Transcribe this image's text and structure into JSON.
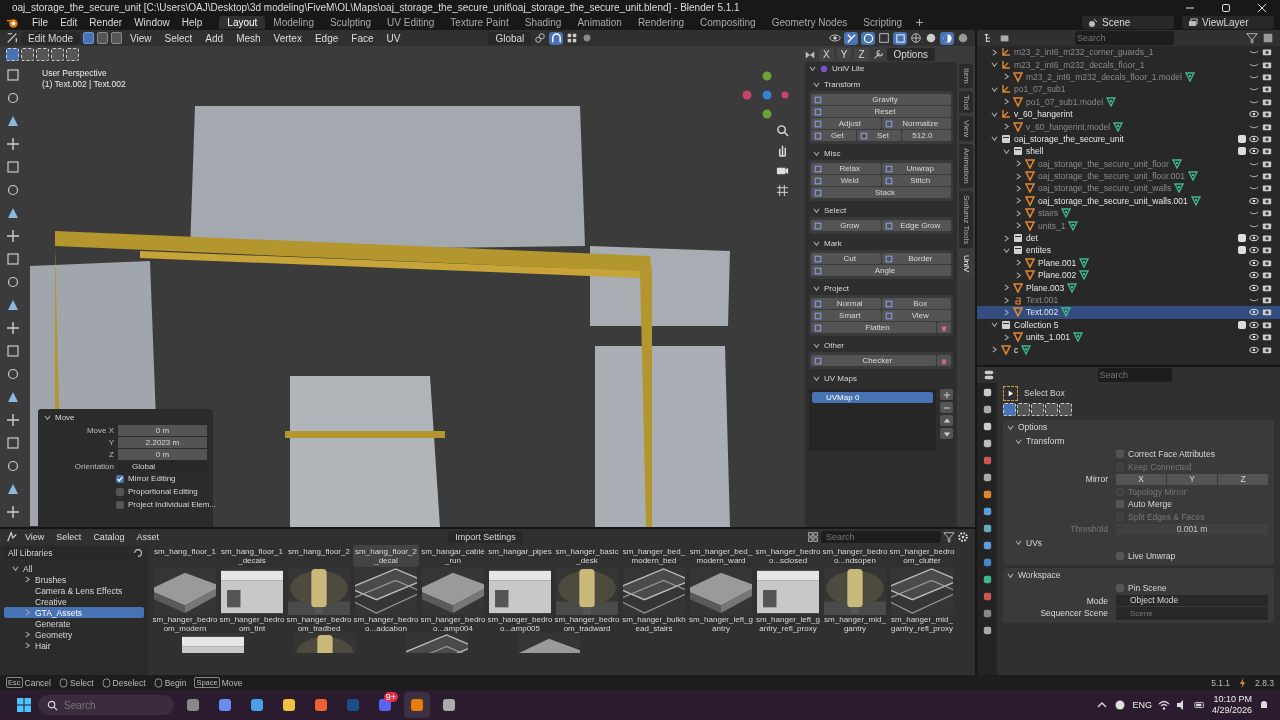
{
  "window": {
    "title": "oaj_storage_the_secure_unit [C:\\Users\\OAJ\\Desktop\\3d modeling\\FiveM\\OL\\Maps\\oaj_storage_the_secure_unit\\oaj_storage_the_secure_unit.blend] - Blender 5.1.1"
  },
  "menu": [
    "File",
    "Edit",
    "Render",
    "Window",
    "Help"
  ],
  "workspaces": [
    {
      "label": "Layout",
      "selected": true
    },
    {
      "label": "Modeling",
      "selected": false
    },
    {
      "label": "Sculpting",
      "selected": false
    },
    {
      "label": "UV Editing",
      "selected": false
    },
    {
      "label": "Texture Paint",
      "selected": false
    },
    {
      "label": "Shading",
      "selected": false
    },
    {
      "label": "Animation",
      "selected": false
    },
    {
      "label": "Rendering",
      "selected": false
    },
    {
      "label": "Compositing",
      "selected": false
    },
    {
      "label": "Geometry Nodes",
      "selected": false
    },
    {
      "label": "Scripting",
      "selected": false
    }
  ],
  "scene": "Scene",
  "view_layer": "ViewLayer",
  "viewport": {
    "mode": "Edit Mode",
    "menus": [
      "View",
      "Select",
      "Add",
      "Mesh",
      "Vertex",
      "Edge",
      "Face",
      "UV"
    ],
    "select_modes": [
      {
        "selected": true
      },
      {
        "selected": false
      },
      {
        "selected": false
      }
    ],
    "orientation": "Global",
    "axes": [
      "X",
      "Y",
      "Z"
    ],
    "options": "Options",
    "view_name": "User Perspective",
    "object_info": "(1) Text.002 | Text.002"
  },
  "operator_panel": {
    "title": "Move",
    "fields": [
      {
        "label": "Move X",
        "value": "0 m"
      },
      {
        "label": "Y",
        "value": "2.2023 m"
      },
      {
        "label": "Z",
        "value": "0 m"
      }
    ],
    "orientation_label": "Orientation",
    "orientation": "Global",
    "options": [
      {
        "label": "Mirror Editing",
        "checked": true
      },
      {
        "label": "Proportional Editing",
        "checked": false
      },
      {
        "label": "Project Individual Elem...",
        "checked": false
      }
    ]
  },
  "sidebar": {
    "addon": "UniV Lite",
    "sections": [
      {
        "title": "Transform",
        "rows": [
          {
            "buttons": [
              {
                "kind": "button",
                "label": "Gravity"
              }
            ]
          },
          {
            "buttons": [
              {
                "kind": "button",
                "label": "Reset"
              }
            ]
          },
          {
            "buttons": [
              {
                "kind": "button",
                "label": "Adjust"
              },
              {
                "kind": "button",
                "label": "Normalize"
              }
            ]
          },
          {
            "buttons": [
              {
                "kind": "button",
                "label": "Get"
              },
              {
                "kind": "button",
                "label": "Set"
              },
              {
                "kind": "field",
                "label": "512.0"
              }
            ]
          }
        ]
      },
      {
        "title": "Misc",
        "rows": [
          {
            "buttons": [
              {
                "kind": "button",
                "label": "Relax"
              },
              {
                "kind": "button",
                "label": "Unwrap"
              }
            ]
          },
          {
            "buttons": [
              {
                "kind": "button",
                "label": "Weld"
              },
              {
                "kind": "button",
                "label": "Stitch"
              }
            ]
          },
          {
            "buttons": [
              {
                "kind": "button",
                "label": "Stack"
              }
            ]
          }
        ]
      },
      {
        "title": "Select",
        "rows": [
          {
            "buttons": [
              {
                "kind": "button",
                "label": "Grow"
              },
              {
                "kind": "button",
                "label": "Edge Grow"
              }
            ]
          }
        ]
      },
      {
        "title": "Mark",
        "rows": [
          {
            "buttons": [
              {
                "kind": "button",
                "label": "Cut"
              },
              {
                "kind": "button",
                "label": "Border"
              }
            ]
          },
          {
            "buttons": [
              {
                "kind": "button",
                "label": "Angle"
              }
            ]
          }
        ]
      },
      {
        "title": "Project",
        "rows": [
          {
            "buttons": [
              {
                "kind": "button",
                "label": "Normal"
              },
              {
                "kind": "button",
                "label": "Box"
              }
            ]
          },
          {
            "buttons": [
              {
                "kind": "button",
                "label": "Smart"
              },
              {
                "kind": "button",
                "label": "View"
              }
            ]
          },
          {
            "buttons": [
              {
                "kind": "button",
                "label": "Flatten"
              },
              {
                "kind": "delete"
              }
            ]
          }
        ]
      },
      {
        "title": "Other",
        "rows": [
          {
            "buttons": [
              {
                "kind": "button",
                "label": "Checker"
              },
              {
                "kind": "delete"
              }
            ]
          }
        ]
      }
    ],
    "uv_maps_title": "UV Maps",
    "uv_maps": [
      {
        "name": "UVMap 0",
        "selected": true
      }
    ],
    "tabs": [
      {
        "label": "Item",
        "selected": false
      },
      {
        "label": "Tool",
        "selected": false
      },
      {
        "label": "View",
        "selected": false
      },
      {
        "label": "Animation",
        "selected": false
      },
      {
        "label": "Sollumz Tools",
        "selected": false
      },
      {
        "label": "UniV",
        "selected": true
      }
    ]
  },
  "outliner": {
    "search_placeholder": "Search",
    "rows": [
      {
        "name": "m23_2_int6_m232_corner_guards_1",
        "kind": "empty",
        "visible": false,
        "expanded": false,
        "selected": false
      },
      {
        "name": "m23_2_int6_m232_decals_floor_1",
        "kind": "empty",
        "visible": false,
        "expanded": true,
        "selected": false,
        "children": [
          {
            "name": "m23_2_int6_m232_decals_floor_1.model",
            "kind": "mesh",
            "visible": false,
            "expanded": false,
            "selected": false
          }
        ]
      },
      {
        "name": "po1_07_sub1",
        "kind": "empty",
        "visible": false,
        "expanded": true,
        "selected": false,
        "children": [
          {
            "name": "po1_07_sub1.model",
            "kind": "mesh",
            "visible": false,
            "expanded": false,
            "selected": false
          }
        ]
      },
      {
        "name": "v_60_hangerint",
        "kind": "empty",
        "visible": true,
        "expanded": true,
        "selected": false,
        "children": [
          {
            "name": "v_60_hangerint.model",
            "kind": "mesh",
            "visible": false,
            "expanded": false,
            "selected": false
          }
        ]
      },
      {
        "name": "oaj_storage_the_secure_unit",
        "kind": "collection",
        "checked": true,
        "visible": true,
        "expanded": true,
        "selected": false,
        "children": [
          {
            "name": "shell",
            "kind": "collection",
            "checked": true,
            "visible": true,
            "expanded": true,
            "selected": false,
            "children": [
              {
                "name": "oaj_storage_the_secure_unit_floor",
                "kind": "mesh",
                "visible": false,
                "expanded": false,
                "selected": false
              },
              {
                "name": "oaj_storage_the_secure_unit_floor.001",
                "kind": "mesh",
                "visible": false,
                "expanded": false,
                "selected": false
              },
              {
                "name": "oaj_storage_the_secure_unit_walls",
                "kind": "mesh",
                "visible": false,
                "expanded": false,
                "selected": false
              },
              {
                "name": "oaj_storage_the_secure_unit_walls.001",
                "kind": "mesh",
                "visible": true,
                "expanded": false,
                "selected": false
              },
              {
                "name": "stairs",
                "kind": "mesh",
                "visible": false,
                "expanded": false,
                "selected": false
              },
              {
                "name": "units_1",
                "kind": "mesh",
                "visible": false,
                "expanded": false,
                "selected": false
              }
            ]
          },
          {
            "name": "det",
            "kind": "collection",
            "checked": true,
            "visible": true,
            "expanded": false,
            "selected": false
          },
          {
            "name": "entites",
            "kind": "collection",
            "checked": true,
            "visible": true,
            "expanded": true,
            "selected": false,
            "children": [
              {
                "name": "Plane.001",
                "kind": "mesh",
                "visible": true,
                "expanded": false,
                "selected": false
              },
              {
                "name": "Plane.002",
                "kind": "mesh",
                "visible": true,
                "expanded": false,
                "selected": false
              }
            ]
          },
          {
            "name": "Plane.003",
            "kind": "mesh",
            "visible": true,
            "expanded": false,
            "selected": false
          },
          {
            "name": "Text.001",
            "kind": "text",
            "visible": false,
            "expanded": false,
            "selected": false
          },
          {
            "name": "Text.002",
            "kind": "mesh",
            "visible": true,
            "expanded": false,
            "selected": true
          }
        ]
      },
      {
        "name": "Collection 5",
        "kind": "collection",
        "checked": true,
        "visible": true,
        "expanded": true,
        "selected": false,
        "children": [
          {
            "name": "units_1.001",
            "kind": "mesh",
            "visible": true,
            "expanded": false,
            "selected": false
          }
        ]
      },
      {
        "name": "c",
        "kind": "mesh",
        "visible": true,
        "expanded": false,
        "selected": false
      }
    ]
  },
  "properties": {
    "search_placeholder": "Search",
    "tool": "Select Box",
    "sections": [
      {
        "title": "Options",
        "groups": [
          {
            "title": "Transform",
            "items": [
              {
                "kind": "checkbox",
                "label": "Correct Face Attributes",
                "checked": false,
                "disabled": false
              },
              {
                "kind": "checkbox",
                "label": "Keep Connected",
                "checked": false,
                "disabled": true
              },
              {
                "kind": "axes",
                "label": "Mirror",
                "axes": [
                  "X",
                  "Y",
                  "Z"
                ]
              },
              {
                "kind": "checkbox",
                "label": "Topology Mirror",
                "checked": false,
                "disabled": true
              },
              {
                "kind": "checkbox",
                "label": "Auto Merge",
                "checked": false,
                "disabled": false
              },
              {
                "kind": "checkbox",
                "label": "Split Edges & Faces",
                "checked": false,
                "disabled": true
              },
              {
                "kind": "number",
                "label": "Threshold",
                "value": "0.001 m",
                "disabled": true
              }
            ]
          },
          {
            "title": "UVs",
            "items": [
              {
                "kind": "checkbox",
                "label": "Live Unwrap",
                "checked": false,
                "disabled": false
              }
            ]
          }
        ]
      },
      {
        "title": "Workspace",
        "groups": [
          {
            "items": [
              {
                "kind": "checkbox",
                "label": "Pin Scene",
                "checked": false,
                "disabled": false
              },
              {
                "kind": "dropdown",
                "label": "Mode",
                "value": "Object Mode"
              },
              {
                "kind": "search",
                "label": "Sequencer Scene",
                "placeholder": "Scene"
              }
            ]
          }
        ]
      }
    ]
  },
  "assets": {
    "menus": [
      "View",
      "Select",
      "Catalog",
      "Asset"
    ],
    "import_settings": "Import Settings",
    "search_placeholder": "Search",
    "library": "All Libraries",
    "catalogs": [
      {
        "label": "All",
        "expanded": true,
        "selected": false,
        "children": [
          {
            "label": "Brushes",
            "expanded": false,
            "selected": false
          },
          {
            "label": "Camera & Lens Effects",
            "selected": false
          },
          {
            "label": "Creative",
            "selected": false
          },
          {
            "label": "GTA_Assets",
            "expanded": false,
            "selected": true
          },
          {
            "label": "Generate",
            "selected": false
          },
          {
            "label": "Geometry",
            "expanded": false,
            "selected": false
          },
          {
            "label": "Hair",
            "expanded": false,
            "selected": false
          }
        ]
      }
    ],
    "label_row": [
      {
        "name": "sm_hang_floor_1",
        "selected": false
      },
      {
        "name": "sm_hang_floor_1_decals",
        "selected": false
      },
      {
        "name": "sm_hang_floor_2",
        "selected": false
      },
      {
        "name": "sm_hang_floor_2_decal",
        "selected": true
      },
      {
        "name": "sm_hangar_cable_run",
        "selected": false
      },
      {
        "name": "sm_hangar_pipes",
        "selected": false
      },
      {
        "name": "sm_hanger_basic_desk",
        "selected": false
      },
      {
        "name": "sm_hanger_bed_modern_bed",
        "selected": false
      },
      {
        "name": "sm_hanger_bed_modern_ward",
        "selected": false
      },
      {
        "name": "sm_hanger_bedroo...sclosed",
        "selected": false
      },
      {
        "name": "sm_hanger_bedroo...ndsopen",
        "selected": false
      },
      {
        "name": "sm_hanger_bedroom_clutter",
        "selected": false
      }
    ],
    "items": [
      {
        "name": "sm_hanger_bedroom_modern",
        "selected": false
      },
      {
        "name": "sm_hanger_bedroom_tint",
        "selected": false
      },
      {
        "name": "sm_hanger_bedroom_tradbed",
        "selected": false
      },
      {
        "name": "sm_hanger_bedroo...adcabon",
        "selected": false
      },
      {
        "name": "sm_hanger_bedroo...amp004",
        "selected": false
      },
      {
        "name": "sm_hanger_bedroo...amp005",
        "selected": false
      },
      {
        "name": "sm_hanger_bedroom_tradward",
        "selected": false
      },
      {
        "name": "sm_hanger_bulkhead_stairs",
        "selected": false
      },
      {
        "name": "sm_hanger_left_gantry",
        "selected": false
      },
      {
        "name": "sm_hanger_left_gantry_refl_proxy",
        "selected": false
      },
      {
        "name": "sm_hanger_mid_gantry",
        "selected": false
      },
      {
        "name": "sm_hanger_mid_gantry_refl_proxy",
        "selected": false
      }
    ]
  },
  "status": {
    "hints": [
      {
        "key": "Esc",
        "label": "Cancel"
      },
      {
        "label": "Select"
      },
      {
        "label": "Deselect"
      },
      {
        "label": "Begin"
      },
      {
        "key": "Space",
        "label": "Move"
      }
    ],
    "version": "5.1.1",
    "addon_version": "2.8.3"
  },
  "taskbar": {
    "search_placeholder": "Search",
    "badge": "9+",
    "language": "ENG",
    "time": "10:10 PM",
    "date": "4/29/2026"
  }
}
